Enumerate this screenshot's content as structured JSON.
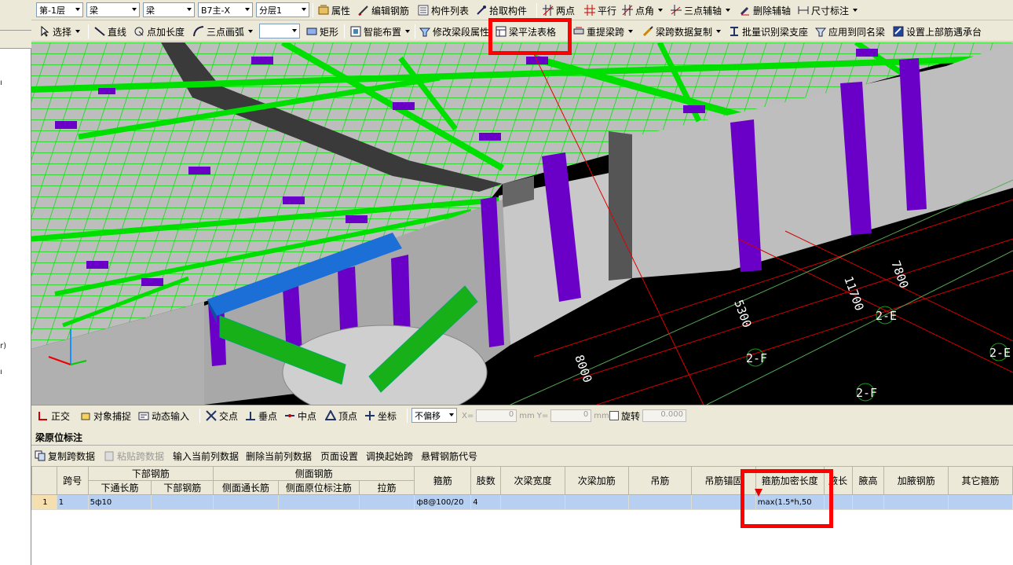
{
  "toolbar1": {
    "floor": "第-1层",
    "type1": "梁",
    "type2": "梁",
    "element": "B7主-X",
    "layer": "分层1",
    "properties": "属性",
    "edit_rebar": "编辑钢筋",
    "component_list": "构件列表",
    "pick_component": "拾取构件",
    "two_points": "两点",
    "parallel": "平行",
    "point_angle": "点角",
    "three_point_axis": "三点辅轴",
    "delete_axis": "删除辅轴",
    "dimension": "尺寸标注"
  },
  "toolbar2": {
    "select": "选择",
    "line": "直线",
    "point_length": "点加长度",
    "three_point_arc": "三点画弧",
    "combo_value": "",
    "rectangle": "矩形",
    "smart_layout": "智能布置",
    "modify_span_props": "修改梁段属性",
    "beam_table": "梁平法表格",
    "re_extract_span": "重提梁跨",
    "span_data_copy": "梁跨数据复制",
    "batch_identify": "批量识别梁支座",
    "apply_same_name": "应用到同名梁",
    "set_top_rebar": "设置上部筋遇承台"
  },
  "viewport": {
    "labels": [
      "7800",
      "11700",
      "5300",
      "8000",
      "2-E",
      "2-F",
      "2-E",
      "2-F"
    ],
    "colors": {
      "slab": "#c0c0c0",
      "rebar": "#00e000",
      "column": "#6a00c8",
      "beam_selected": "#1b6fd6",
      "background": "#000000"
    }
  },
  "snapbar": {
    "ortho": "正交",
    "object_snap": "对象捕捉",
    "dynamic_input": "动态输入",
    "intersection": "交点",
    "perpendicular": "垂点",
    "midpoint": "中点",
    "vertex": "顶点",
    "coordinate": "坐标",
    "offset_mode": "不偏移",
    "x_label": "X=",
    "x_value": "0",
    "y_label": "Y=",
    "y_value": "0",
    "unit": "mm",
    "rotate": "旋转",
    "rotate_value": "0.000"
  },
  "panel": {
    "title": "梁原位标注",
    "tools": [
      "复制跨数据",
      "粘贴跨数据",
      "输入当前列数据",
      "删除当前列数据",
      "页面设置",
      "调换起始跨",
      "悬臂钢筋代号"
    ]
  },
  "table": {
    "group_headers": {
      "bottom_rebar": "下部钢筋",
      "side_rebar": "侧面钢筋"
    },
    "headers": [
      "跨号",
      "下通长筋",
      "下部钢筋",
      "侧面通长筋",
      "侧面原位标注筋",
      "拉筋",
      "箍筋",
      "肢数",
      "次梁宽度",
      "次梁加筋",
      "吊筋",
      "吊筋锚固",
      "箍筋加密长度",
      "腋长",
      "腋高",
      "加腋钢筋",
      "其它箍筋"
    ],
    "rows": [
      {
        "row_no": "1",
        "span": "1",
        "bottom_through": "5ф10",
        "bottom": "",
        "side_through": "",
        "side_inplace": "",
        "tie": "",
        "stirrup": "ф8@100/20",
        "legs": "4",
        "sec_width": "",
        "sec_add": "",
        "hanger": "",
        "hanger_anchor": "",
        "dense_length": "max(1.5*h,50",
        "haunch_len": "",
        "haunch_h": "",
        "haunch_rebar": "",
        "other_stirrup": ""
      }
    ]
  }
}
